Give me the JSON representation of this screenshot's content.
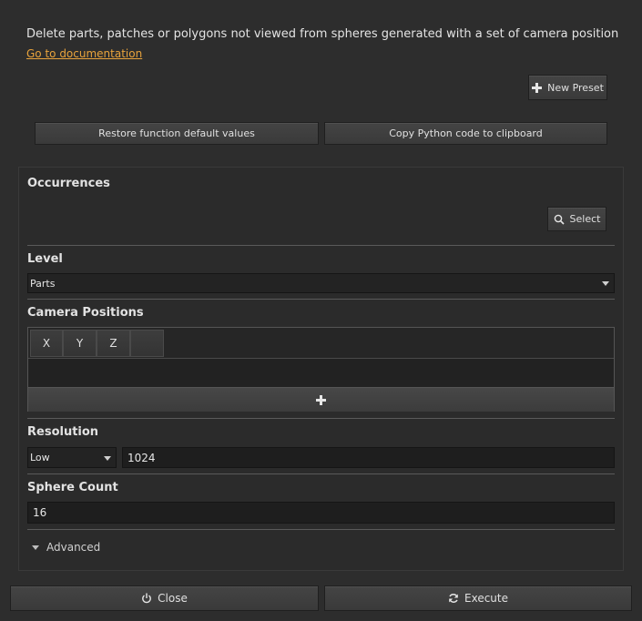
{
  "header": {
    "description": "Delete parts, patches or polygons not viewed from spheres generated with a set of camera position",
    "doc_link": "Go to documentation"
  },
  "toolbar": {
    "new_preset": "New Preset",
    "restore_defaults": "Restore function default values",
    "copy_python": "Copy Python code to clipboard"
  },
  "occurrences": {
    "title": "Occurrences",
    "select_label": "Select"
  },
  "level": {
    "title": "Level",
    "value": "Parts"
  },
  "camera_positions": {
    "title": "Camera Positions",
    "columns": [
      "X",
      "Y",
      "Z",
      ""
    ]
  },
  "resolution": {
    "title": "Resolution",
    "preset": "Low",
    "value": "1024"
  },
  "sphere_count": {
    "title": "Sphere Count",
    "value": "16"
  },
  "advanced": {
    "label": "Advanced"
  },
  "footer": {
    "close_label": "Close",
    "execute_label": "Execute"
  },
  "colors": {
    "link": "#e8a33c",
    "background": "#2d2d2d"
  }
}
